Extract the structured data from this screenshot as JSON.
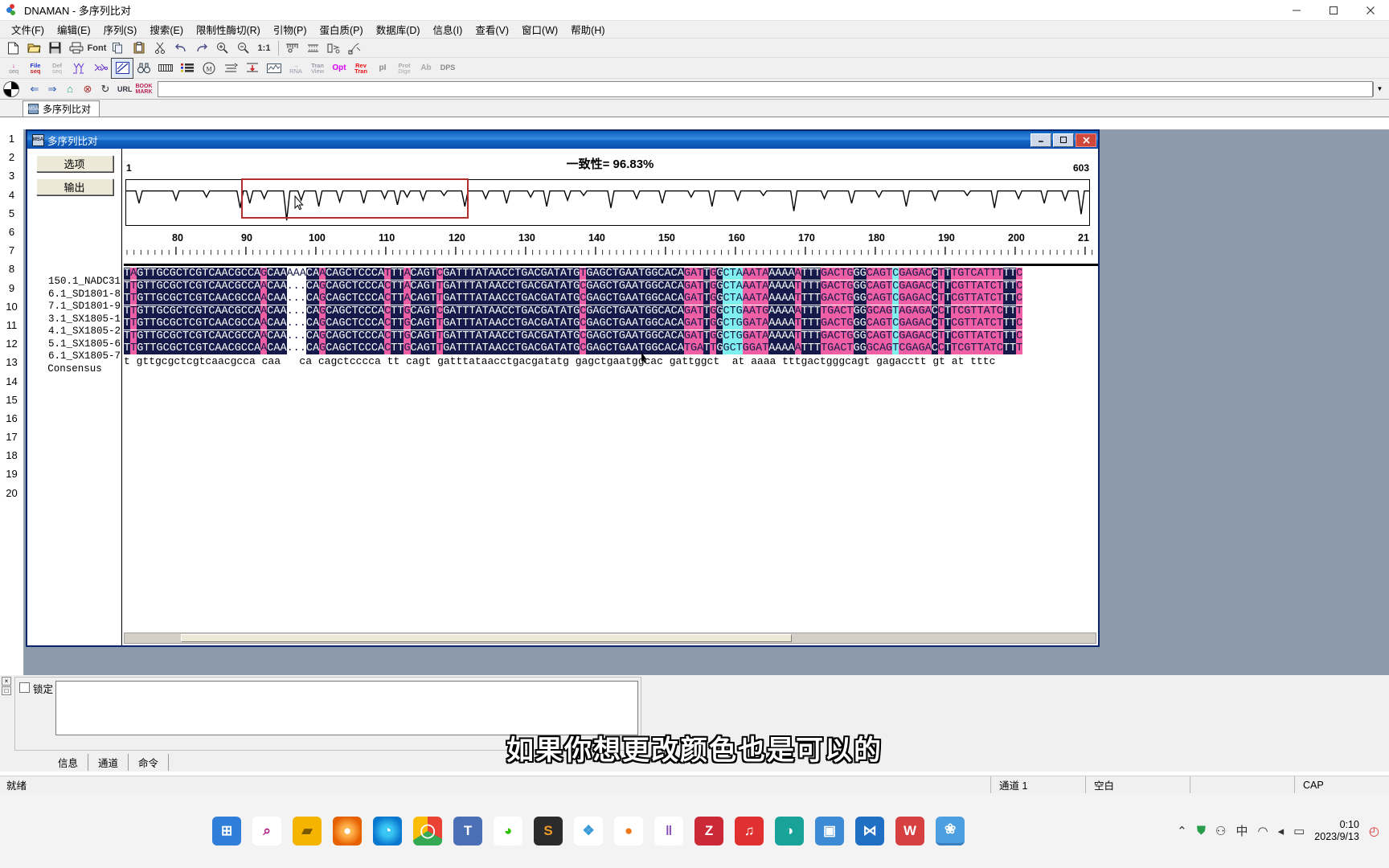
{
  "window": {
    "title": "DNAMAN - 多序列比对",
    "app_icon": "dnaman-icon",
    "minimize": "–",
    "maximize": "□",
    "close": "✕"
  },
  "menubar": {
    "items": [
      {
        "label": "文件(F)",
        "name": "menu-file"
      },
      {
        "label": "编辑(E)",
        "name": "menu-edit"
      },
      {
        "label": "序列(S)",
        "name": "menu-sequence"
      },
      {
        "label": "搜索(E)",
        "name": "menu-search"
      },
      {
        "label": "限制性酶切(R)",
        "name": "menu-restriction"
      },
      {
        "label": "引物(P)",
        "name": "menu-primer"
      },
      {
        "label": "蛋白质(P)",
        "name": "menu-protein"
      },
      {
        "label": "数据库(D)",
        "name": "menu-database"
      },
      {
        "label": "信息(I)",
        "name": "menu-info"
      },
      {
        "label": "查看(V)",
        "name": "menu-view"
      },
      {
        "label": "窗口(W)",
        "name": "menu-window"
      },
      {
        "label": "帮助(H)",
        "name": "menu-help"
      }
    ]
  },
  "toolbar1": {
    "buttons": [
      {
        "label": "",
        "name": "new-file-button",
        "glyph": "page"
      },
      {
        "label": "",
        "name": "open-file-button",
        "glyph": "folder"
      },
      {
        "label": "",
        "name": "save-file-button",
        "glyph": "save"
      },
      {
        "label": "",
        "name": "print-button",
        "glyph": "printer"
      },
      {
        "label": "Font",
        "name": "font-button",
        "glyph": "text"
      },
      {
        "label": "",
        "name": "copy-button",
        "glyph": "copy"
      },
      {
        "label": "",
        "name": "paste-button",
        "glyph": "paste"
      },
      {
        "label": "",
        "name": "cut-button",
        "glyph": "scissors"
      },
      {
        "label": "",
        "name": "undo-button",
        "glyph": "undo"
      },
      {
        "label": "",
        "name": "redo-button",
        "glyph": "redo"
      },
      {
        "label": "",
        "name": "zoom-in-button",
        "glyph": "zoomin"
      },
      {
        "label": "",
        "name": "zoom-out-button",
        "glyph": "zoomout"
      },
      {
        "label": "1:1",
        "name": "zoom-reset-button",
        "glyph": "text"
      },
      {
        "label": "",
        "name": "restriction-map-button",
        "glyph": "rmap"
      },
      {
        "label": "",
        "name": "restriction-analysis-button",
        "glyph": "ranal"
      },
      {
        "label": "",
        "name": "enzyme-cut-button",
        "glyph": "ecut"
      },
      {
        "label": "",
        "name": "enzyme-digest-button",
        "glyph": "edig"
      }
    ]
  },
  "toolbar2": {
    "buttons": [
      {
        "l1": "↓",
        "l2": "seq",
        "name": "load-seq-button",
        "selected": false
      },
      {
        "l1": "File",
        "l2": "seq",
        "name": "file-seq-button",
        "selected": false
      },
      {
        "l1": "Def",
        "l2": "seq",
        "name": "def-seq-button",
        "selected": false
      },
      {
        "l1": "",
        "l2": "",
        "name": "multi-seq-button",
        "selected": false
      },
      {
        "l1": "",
        "l2": "",
        "name": "consensus-button",
        "selected": false
      },
      {
        "l1": "",
        "l2": "",
        "name": "alignment-plot-button",
        "selected": true
      },
      {
        "l1": "",
        "l2": "",
        "name": "find-button",
        "selected": false
      },
      {
        "l1": "",
        "l2": "",
        "name": "restriction-ruler-button",
        "selected": false
      },
      {
        "l1": "",
        "l2": "",
        "name": "list-button",
        "selected": false
      },
      {
        "l1": "",
        "l2": "",
        "name": "circular-map-button",
        "selected": false
      },
      {
        "l1": "",
        "l2": "",
        "name": "ligate-button",
        "selected": false
      },
      {
        "l1": "",
        "l2": "",
        "name": "insert-button",
        "selected": false
      },
      {
        "l1": "",
        "l2": "",
        "name": "plot-button",
        "selected": false
      },
      {
        "l1": "→",
        "l2": "RNA",
        "name": "rna-button",
        "selected": false
      },
      {
        "l1": "Tran",
        "l2": "View",
        "name": "tran-view-button",
        "selected": false
      },
      {
        "l1": "Opt",
        "l2": "",
        "name": "opt-button",
        "selected": false
      },
      {
        "l1": "Rev",
        "l2": "Tran",
        "name": "rev-tran-button",
        "selected": false
      },
      {
        "l1": "pI",
        "l2": "",
        "name": "pi-button",
        "selected": false
      },
      {
        "l1": "Prot",
        "l2": "Dige",
        "name": "prot-dige-button",
        "selected": false
      },
      {
        "l1": "Ab",
        "l2": "",
        "name": "antibody-button",
        "selected": false
      },
      {
        "l1": "DPS",
        "l2": "",
        "name": "dps-button",
        "selected": false
      }
    ]
  },
  "urlbar": {
    "value": "",
    "placeholder": "",
    "url_label": "URL",
    "bookmark_label": "BOOK MARK",
    "back": "⇐",
    "forward": "⇒",
    "home": "⌂",
    "stop": "⊗",
    "refresh": "↻",
    "dropdown": "▼"
  },
  "doc_tab": {
    "label": "多序列比对",
    "icon": "msa-icon"
  },
  "row_gutter": {
    "numbers": [
      "1",
      "2",
      "3",
      "4",
      "5",
      "6",
      "7",
      "8",
      "9",
      "10",
      "11",
      "12",
      "13",
      "14",
      "15",
      "16",
      "17",
      "18",
      "19",
      "20"
    ]
  },
  "mdi_window": {
    "title": "多序列比对",
    "icon": "msa-icon",
    "minimize": "–",
    "maximize": "□",
    "close": "✕"
  },
  "side_panel": {
    "buttons": [
      {
        "label": "选项",
        "name": "options-button"
      },
      {
        "label": "输出",
        "name": "output-button"
      }
    ]
  },
  "alignment": {
    "identity_label": "一致性= 96.83%",
    "profile_start": "1",
    "profile_end": "603",
    "ruler_numbers": [
      "80",
      "90",
      "100",
      "110",
      "120",
      "130",
      "140",
      "150",
      "160",
      "170",
      "180",
      "190",
      "200",
      "21"
    ],
    "sequence_names": [
      "150.1_NADC31",
      "6.1_SD1801-8",
      "7.1_SD1801-9",
      "3.1_SX1805-1",
      "4.1_SX1805-2",
      "5.1_SX1805-6",
      "6.1_SX1805-7",
      "Consensus"
    ],
    "rows": [
      "TAGTTGCGCTCGTCAACGCCAGCAAAAACAACAGCTCCCATTTACAGTCGATTTATAACCTGACGATATGTGAGCTGAATGGCACAGATTGGCTAAATAAAAAATTTGACTGGGCAGTCGAGACCTTTGTCATTTTTC",
      "TTGTTGCGCTCGTCAACGCCAACAA...CAGCAGCTCCCACTTACAGTTGATTTATAACCTGACGATATGCGAGCTGAATGGCACAGATTGGCTAAATAAAAATTTTGACTGGGCAGTCGAGACCTTCGTTATCTTTC",
      "TTGTTGCGCTCGTCAACGCCAACAA...CAGCAGCTCCCACTTACAGTTGATTTATAACCTGACGATATGCGAGCTGAATGGCACAGATTGGCTAAATAAAAATTTTGACTGGGCAGTCGAGACCTTCGTTATCTTTC",
      "TTGTTGCGCTCGTCAACGCCAACAA...CAGCAGCTCCCACTTGCAGTCGATTTATAACCTGACGATATGCGAGCTGAATGGCACAGATTGGCTGAATGAAAAATTTTGACTGGGCAGTAGAGACCTTCGTTATCTTTC",
      "TTGTTGCGCTCGTCAACGCCAACAA...CAGCAGCTCCCACTTGCAGTTGATTTATAACCTGACGATATGCGAGCTGAATGGCACAGATTGGCTGGATAAAAATTTTGACTGGGCAGTCGAGACCTTCGTTATCTTTC",
      "TTGTTGCGCTCGTCAACGCCAACAA...CAGCAGCTCCCACTTGCAGTTGATTTATAACCTGACGATATGCGAGCTGAATGGCACAGATTGGCTGGATAAAAATTTTGACTGGGCAGTCGAGACCTTCGTTATCTTTC",
      "TTGTTGCGCTCGTCAACGCCAACAA...CAGCAGCTCCCACTTGCAGTTGATTTATAACCTGACGATATGCGAGCTGAATGGCACATGATTGGCTGGATAAAAATTTTGACTGGGCAGTCGAGACCTTCGTTATCTTTC",
      "t gttgcgctcgtcaacgcca caa   ca cagctcccca tt cagt gatttataacctgacgatatg gagctgaatggcac gattggct  at aaaa tttgactgggcagt gagacctt gt at tttc"
    ],
    "highlight_colors": {
      "dark": "#151a4a",
      "pink": "#ef5fa5",
      "cyan": "#7ff0ee",
      "white": "#ffffff"
    },
    "selection_box_color": "#b03030"
  },
  "bottom_panel": {
    "lock_label": "锁定",
    "lock_checked": false,
    "textarea_value": "",
    "tabs": [
      {
        "label": "信息",
        "name": "tab-info"
      },
      {
        "label": "通道",
        "name": "tab-channel"
      },
      {
        "label": "命令",
        "name": "tab-command"
      }
    ]
  },
  "statusbar": {
    "ready": "就绪",
    "channel": "通道 1",
    "blank": "空白",
    "empty": "",
    "cap": "CAP"
  },
  "caption": {
    "text": "如果你想更改颜色也是可以的"
  },
  "taskbar": {
    "icons": [
      {
        "name": "start-windows-icon",
        "glyph": "⊞",
        "color": "#2f7fd8"
      },
      {
        "name": "search-icon",
        "glyph": "⚲",
        "color": "#b0228c"
      },
      {
        "name": "file-explorer-icon",
        "glyph": "▰",
        "color": "#f4b400"
      },
      {
        "name": "firefox-icon",
        "glyph": "●",
        "color": "#e66000"
      },
      {
        "name": "edge-icon",
        "glyph": "◔",
        "color": "#0b78d0"
      },
      {
        "name": "chrome-icon",
        "glyph": "◯",
        "color": "#4285f4"
      },
      {
        "name": "typora-icon",
        "glyph": "T",
        "color": "#4a6fb5"
      },
      {
        "name": "wechat-icon",
        "glyph": "◕",
        "color": "#2dc100"
      },
      {
        "name": "sublime-icon",
        "glyph": "S",
        "color": "#2b2b2b"
      },
      {
        "name": "app-blue-icon",
        "glyph": "❖",
        "color": "#3a9ad9"
      },
      {
        "name": "app-orange-icon",
        "glyph": "●",
        "color": "#f07818"
      },
      {
        "name": "chart-app-icon",
        "glyph": "‖",
        "color": "#8a4fb5"
      },
      {
        "name": "zotero-icon",
        "glyph": "Z",
        "color": "#cc2936"
      },
      {
        "name": "music-app-icon",
        "glyph": "♫",
        "color": "#e03030"
      },
      {
        "name": "teal-app-icon",
        "glyph": "◑",
        "color": "#17a398"
      },
      {
        "name": "sticky-app-icon",
        "glyph": "▣",
        "color": "#3d8bd4"
      },
      {
        "name": "matrix-app-icon",
        "glyph": "⋈",
        "color": "#1f6fc4"
      },
      {
        "name": "wps-icon",
        "glyph": "W",
        "color": "#d64040"
      },
      {
        "name": "dnaman-taskbar-icon",
        "glyph": "❀",
        "color": "#4c9fe0"
      }
    ],
    "tray": {
      "chevron": "⌃",
      "shield": "⛊",
      "mic": "⚇",
      "ime": "中",
      "wifi": "◠",
      "volume": "◂",
      "battery": "▭",
      "time": "0:10",
      "date": "2023/9/13",
      "notification": "◴"
    }
  }
}
